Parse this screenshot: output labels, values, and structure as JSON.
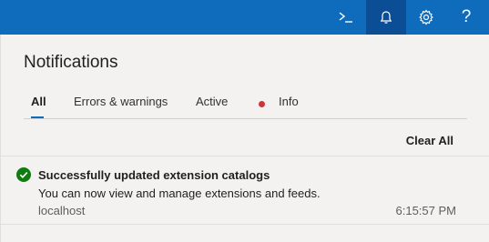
{
  "topbar": {
    "buttons": [
      {
        "icon": "terminal-icon"
      },
      {
        "icon": "bell-icon"
      },
      {
        "icon": "gear-icon"
      },
      {
        "icon": "help-icon",
        "label": "?"
      }
    ]
  },
  "panel": {
    "title": "Notifications",
    "tabs": [
      {
        "label": "All",
        "selected": true
      },
      {
        "label": "Errors & warnings"
      },
      {
        "label": "Active"
      },
      {
        "label": "Info"
      }
    ],
    "clear_all": "Clear All",
    "notifications": [
      {
        "status_icon": "success-check-icon",
        "title": "Successfully updated extension catalogs",
        "body": "You can now view and manage extensions and feeds.",
        "source": "localhost",
        "time": "6:15:57 PM"
      }
    ]
  },
  "colors": {
    "topbar": "#0f6cbd",
    "active_button": "#0b4e96",
    "success": "#107c10",
    "info_dot": "#d13438",
    "tab_underline": "#0f6cbd"
  }
}
